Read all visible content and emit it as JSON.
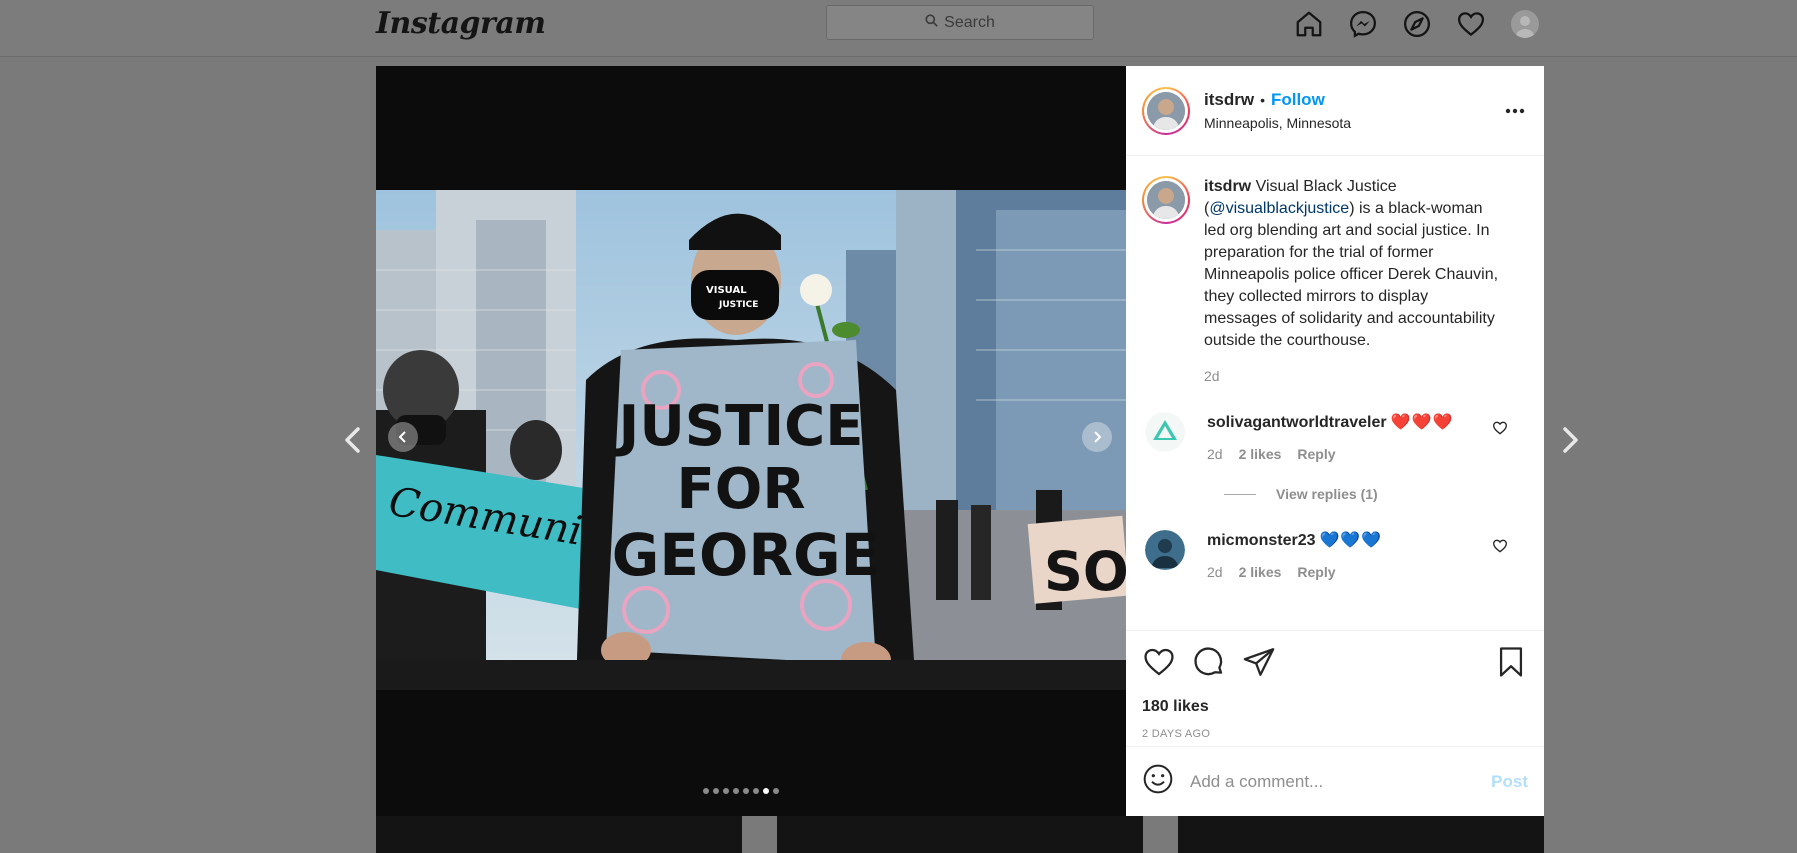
{
  "topnav": {
    "logo": "Instagram",
    "search_placeholder": "Search",
    "icons": [
      "home-icon",
      "messenger-icon",
      "explore-icon",
      "heart-icon",
      "profile-avatar"
    ]
  },
  "post": {
    "username": "itsdrw",
    "separator": "•",
    "follow_label": "Follow",
    "location": "Minneapolis, Minnesota",
    "more_icon": "more-options-icon",
    "image": {
      "sign_text": [
        "JUSTICE",
        "FOR",
        "GEORGE"
      ],
      "mask_text": [
        "VISUAL",
        "JUSTICE"
      ],
      "banner_text": "Community looks like",
      "right_sign_text": "SO"
    },
    "carousel": {
      "slide_count": 8,
      "active_index": 6
    },
    "caption": {
      "user": "itsdrw",
      "text_prefix": " Visual Black Justice (",
      "mention": "@visualblackjustice",
      "text_suffix": ") is a black-woman led org blending art and social justice. In preparation for the trial of former Minneapolis police officer Derek Chauvin, they collected mirrors to display messages of solidarity and accountability outside the courthouse.",
      "time": "2d"
    },
    "comments": [
      {
        "user": "solivagantworldtraveler",
        "emoji": "❤️❤️❤️",
        "time": "2d",
        "likes": "2 likes",
        "reply": "Reply",
        "view_replies": "View replies (1)"
      },
      {
        "user": "micmonster23",
        "emoji": "💙💙💙",
        "time": "2d",
        "likes": "2 likes",
        "reply": "Reply"
      }
    ],
    "likes": "180 likes",
    "posted": "2 DAYS AGO",
    "add_comment_placeholder": "Add a comment...",
    "post_label": "Post"
  },
  "colors": {
    "accent": "#0095f6",
    "post_disabled": "#b2dffc",
    "meta": "#8e8e8e"
  }
}
